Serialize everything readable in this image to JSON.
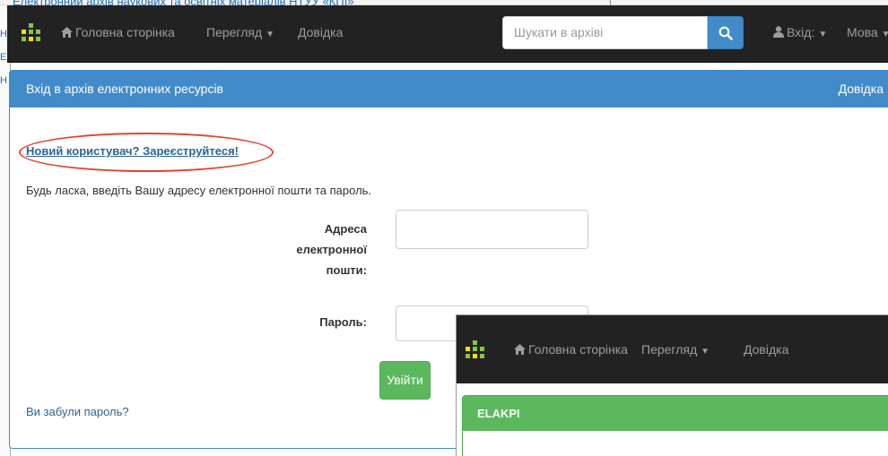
{
  "background": {
    "title": "Електронний архів наукових та освітніх матеріалів НТУУ «КПІ»",
    "left_links": [
      "Н",
      "Е",
      "Н"
    ]
  },
  "navbar": {
    "home_label": "Головна сторінка",
    "browse_label": "Перегляд",
    "help_label": "Довідка",
    "search_placeholder": "Шукати в архіві",
    "login_label": "Вхід:",
    "language_label": "Мова"
  },
  "login_panel": {
    "title": "Вхід в архів електронних ресурсів",
    "help_label": "Довідка",
    "register_link": "Новий користувач? Зареєструйтеся!",
    "instructions": "Будь ласка, введіть Вашу адресу електронної пошти та пароль.",
    "email_label": "Адреса електронної пошти:",
    "email_value": "",
    "password_label": "Пароль:",
    "password_value": "",
    "login_button": "Увійти",
    "forgot_link": "Ви забули пароль?"
  },
  "overlay": {
    "home_label": "Головна сторінка",
    "browse_label": "Перегляд",
    "help_label": "Довідка",
    "panel_title": "ELAKPI"
  },
  "colors": {
    "navbar_bg": "#222222",
    "primary": "#428bca",
    "success": "#5cb85c",
    "highlight": "#e2462a",
    "logo_green": "#8bc34a",
    "logo_yellow": "#f5e000"
  }
}
